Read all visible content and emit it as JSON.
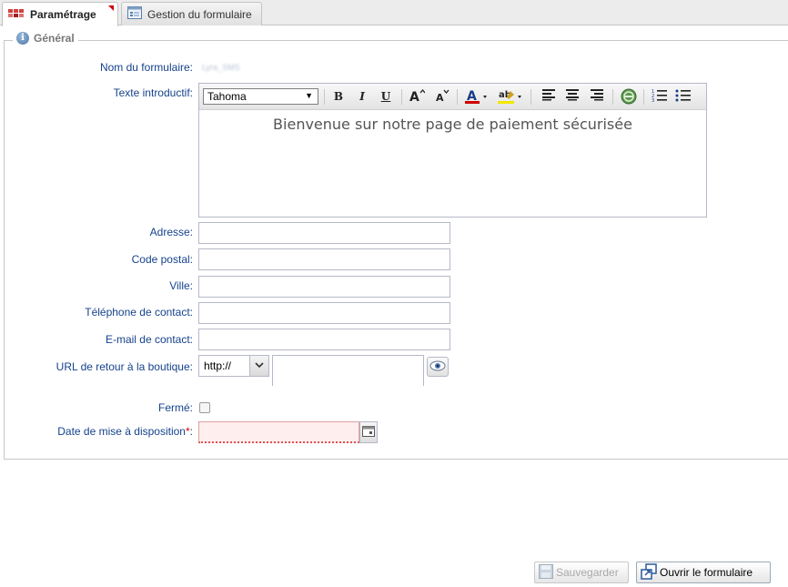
{
  "tabs": [
    {
      "label": "Paramétrage",
      "icon": "grid-icon",
      "active": true
    },
    {
      "label": "Gestion du formulaire",
      "icon": "form-icon",
      "active": false
    }
  ],
  "section": {
    "legend": "Général",
    "icon": "info-icon"
  },
  "fields": {
    "form_name": {
      "label": "Nom du formulaire:",
      "value": "Lyra_SMS"
    },
    "intro": {
      "label": "Texte introductif:",
      "font": "Tahoma",
      "content": "Bienvenue sur notre page de paiement sécurisée"
    },
    "address": {
      "label": "Adresse:",
      "value": ""
    },
    "postal": {
      "label": "Code postal:",
      "value": ""
    },
    "city": {
      "label": "Ville:",
      "value": ""
    },
    "phone": {
      "label": "Téléphone de contact:",
      "value": ""
    },
    "email": {
      "label": "E-mail de contact:",
      "value": ""
    },
    "return_url": {
      "label": "URL de retour à la boutique:",
      "protocol": "http://",
      "value": ""
    },
    "closed": {
      "label": "Fermé:",
      "checked": false
    },
    "availability_date": {
      "label": "Date de mise à disposition",
      "required_mark": "*",
      "colon": ":",
      "value": ""
    }
  },
  "toolbar": {
    "icons": [
      "bold-icon",
      "italic-icon",
      "underline-icon",
      "grow-font-icon",
      "shrink-font-icon",
      "font-color-icon",
      "highlight-icon",
      "align-left-icon",
      "align-center-icon",
      "align-right-icon",
      "link-icon",
      "ordered-list-icon",
      "bullet-list-icon"
    ],
    "bold": "B",
    "italic": "I",
    "underline": "U"
  },
  "buttons": {
    "save": {
      "label": "Sauvegarder",
      "enabled": false,
      "icon": "floppy-icon"
    },
    "open": {
      "label": "Ouvrir le formulaire",
      "enabled": true,
      "icon": "open-window-icon"
    }
  },
  "colors": {
    "label": "#15428b",
    "required": "#dd0000",
    "invalid_bg": "#ffeeee"
  }
}
